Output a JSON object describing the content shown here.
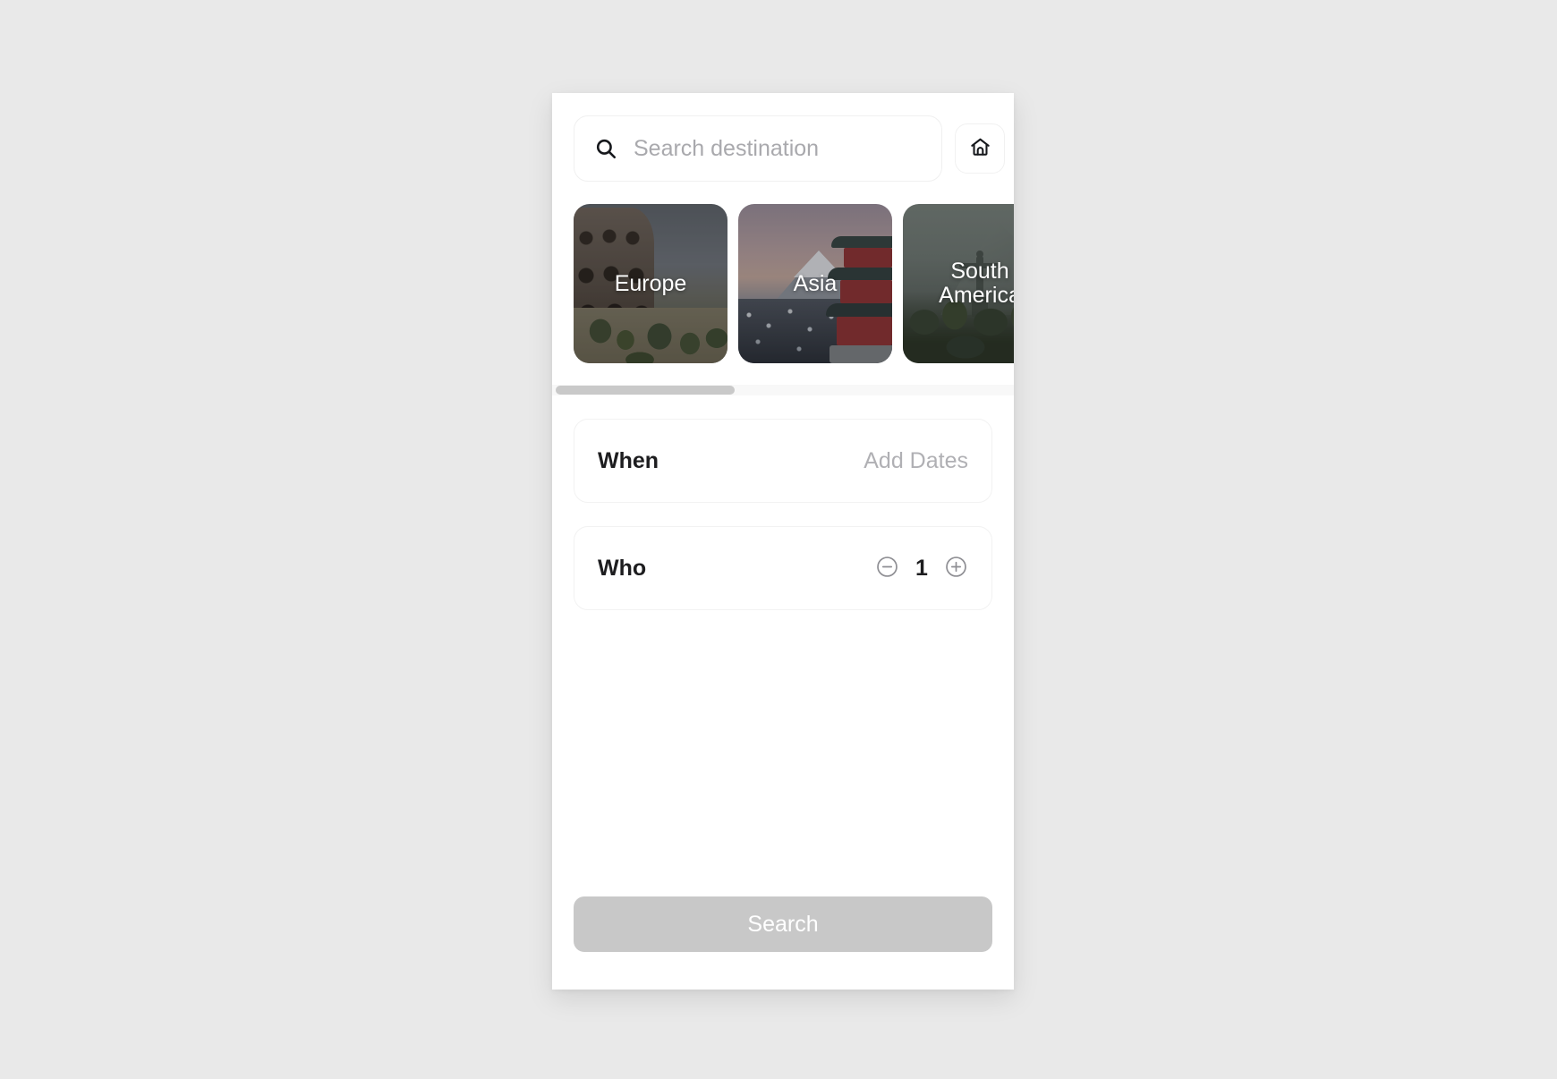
{
  "search": {
    "placeholder": "Search destination",
    "value": "",
    "icon": "search-icon",
    "home_icon": "home-icon"
  },
  "destinations": {
    "items": [
      {
        "label": "Europe",
        "art": "colosseum"
      },
      {
        "label": "Asia",
        "art": "mount-fuji-pagoda"
      },
      {
        "label": "South America",
        "art": "christ-the-redeemer"
      }
    ]
  },
  "fields": [
    {
      "label": "When",
      "value": "Add Dates",
      "type": "text"
    },
    {
      "label": "Who",
      "value": "1",
      "type": "stepper",
      "decrement_icon": "minus-circle-icon",
      "increment_icon": "plus-circle-icon"
    }
  ],
  "footer": {
    "search_label": "Search"
  },
  "colors": {
    "background": "#e9e9e9",
    "panel": "#ffffff",
    "text_primary": "#1d1d1f",
    "text_muted": "#b0b0b4",
    "border": "#f1f1f1",
    "button_disabled": "#c8c8c8",
    "scrollbar_thumb": "#c9c9c9"
  }
}
